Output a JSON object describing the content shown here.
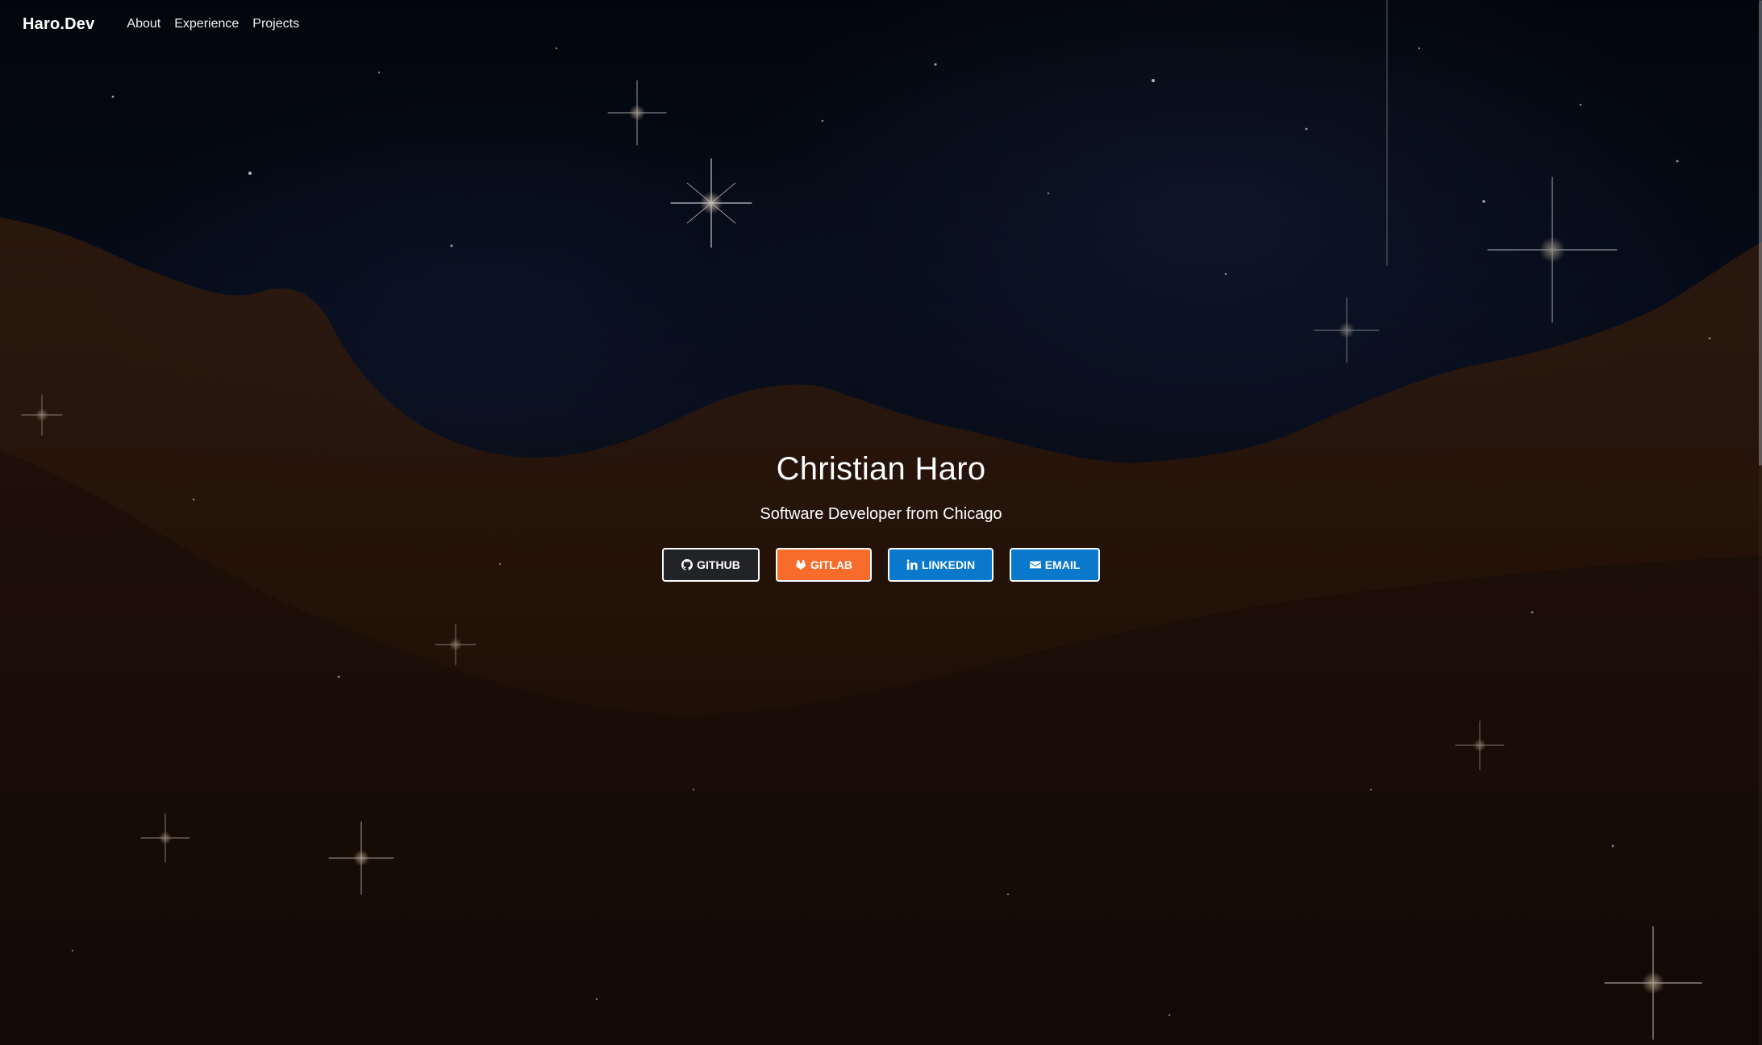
{
  "navbar": {
    "brand": "Haro.Dev",
    "links": [
      {
        "label": "About"
      },
      {
        "label": "Experience"
      },
      {
        "label": "Projects"
      }
    ]
  },
  "hero": {
    "title": "Christian Haro",
    "subtitle": "Software Developer from Chicago",
    "buttons": [
      {
        "label": "GITHUB",
        "icon": "github-icon",
        "color": "#222326"
      },
      {
        "label": "GITLAB",
        "icon": "gitlab-icon",
        "color": "#f76c2a"
      },
      {
        "label": "LINKEDIN",
        "icon": "linkedin-icon",
        "color": "#0a79cc"
      },
      {
        "label": "EMAIL",
        "icon": "envelope-icon",
        "color": "#0a79cc"
      }
    ]
  },
  "colors": {
    "background": "#05070d",
    "nebula": "#3a1e0e",
    "text": "#ffffff"
  }
}
